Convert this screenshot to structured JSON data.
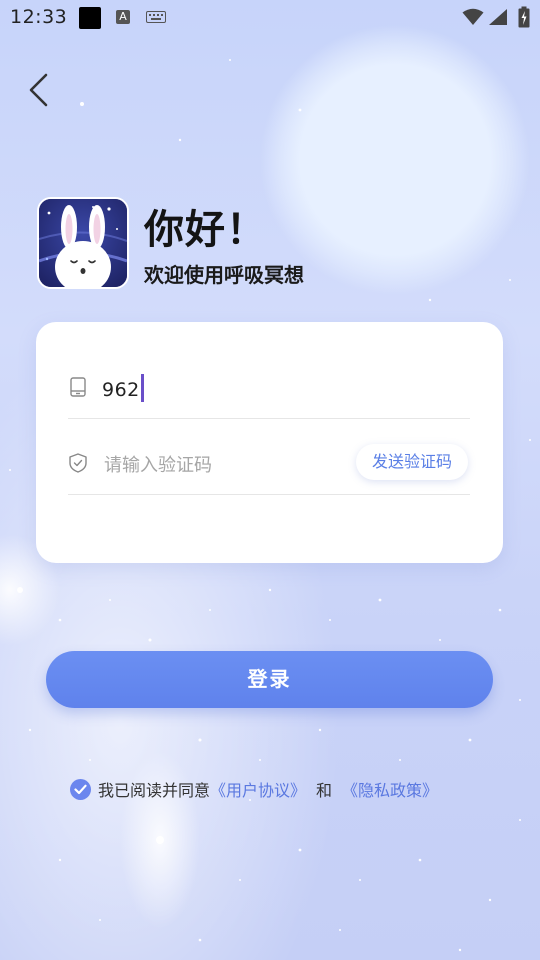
{
  "status_bar": {
    "time": "12:33",
    "icons": [
      "notification-black-square",
      "a-icon",
      "keyboard-icon",
      "wifi-icon",
      "signal-icon",
      "battery-icon"
    ]
  },
  "nav": {
    "back_icon": "chevron-left-icon"
  },
  "header": {
    "logo": "rabbit-logo",
    "title": "你好！",
    "subtitle": "欢迎使用呼吸冥想"
  },
  "form": {
    "phone": {
      "icon": "phone-icon",
      "value": "962"
    },
    "code": {
      "icon": "shield-check-icon",
      "placeholder": "请输入验证码",
      "send_label": "发送验证码"
    }
  },
  "login_button": {
    "label": "登录"
  },
  "agreement": {
    "checked": true,
    "text": "我已阅读并同意",
    "user_agreement": "《用户协议》",
    "and": "和",
    "privacy_policy": "《隐私政策》"
  },
  "colors": {
    "accent": "#6584ef",
    "link": "#5a78e0",
    "background": "#cbd6fa"
  }
}
